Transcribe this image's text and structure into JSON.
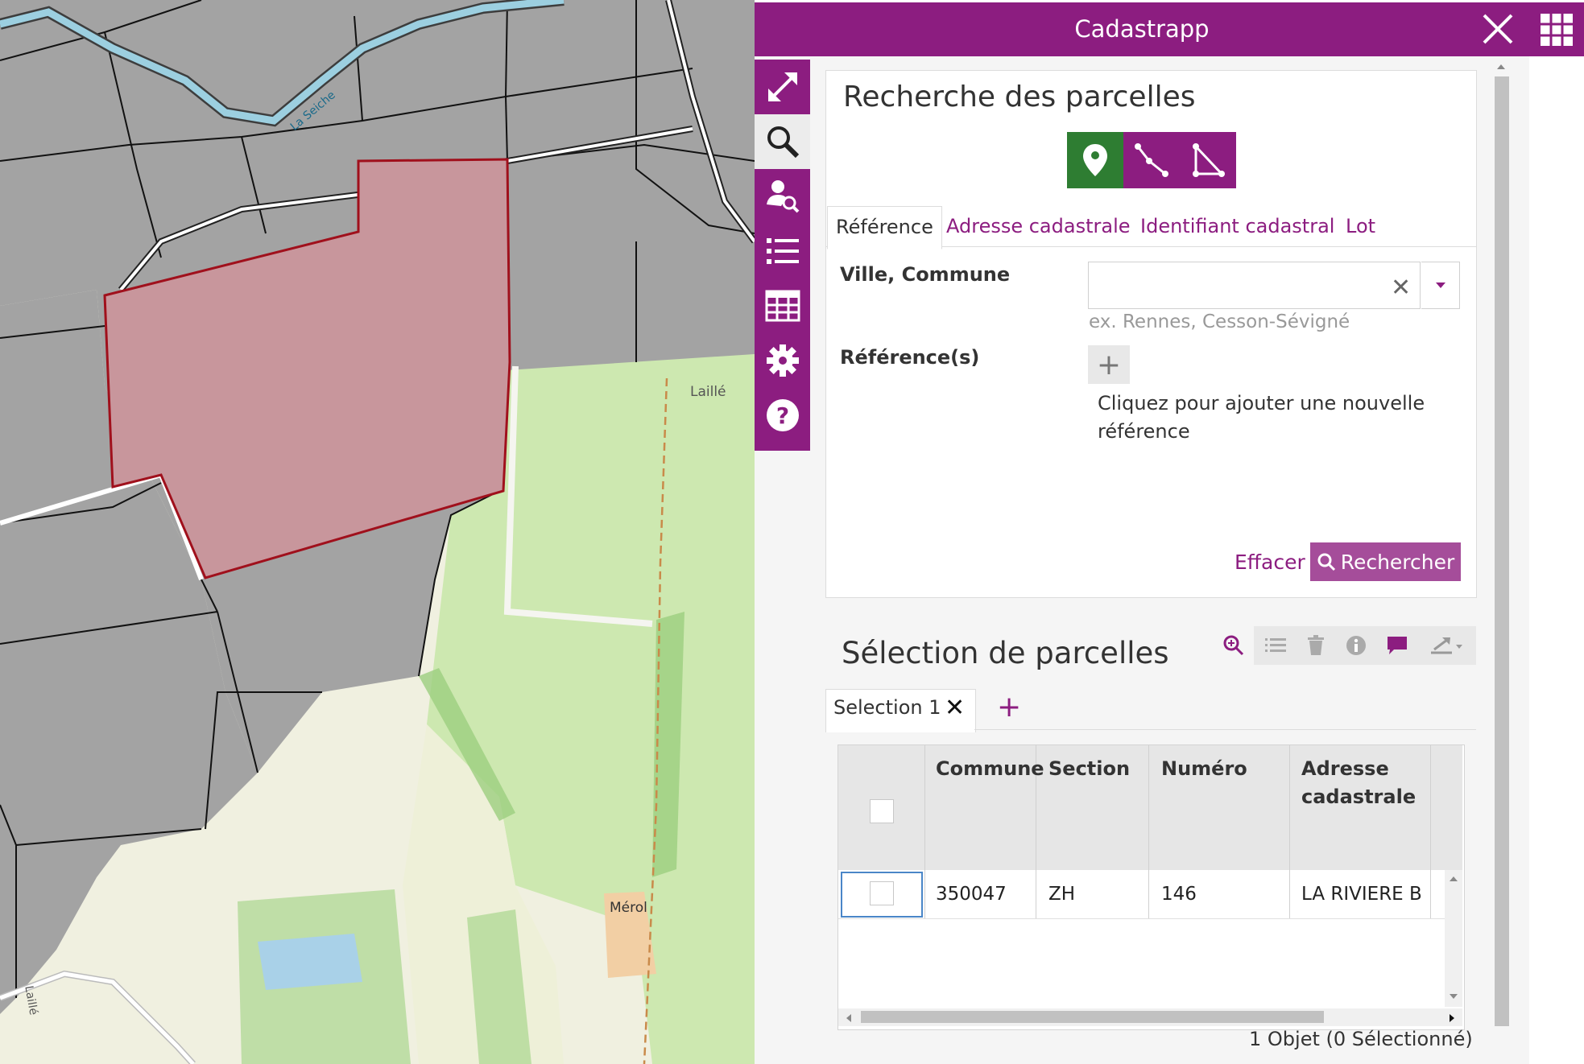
{
  "app": {
    "title": "Cadastrapp"
  },
  "map": {
    "labels": {
      "river": "La Seiche",
      "town_north": "Laillé",
      "hamlet": "Mérol",
      "town_south": "Laillé"
    }
  },
  "toolbar": {
    "items": [
      {
        "icon": "expand-icon"
      },
      {
        "icon": "search-icon"
      },
      {
        "icon": "owner-search-icon"
      },
      {
        "icon": "list-icon"
      },
      {
        "icon": "table-icon"
      },
      {
        "icon": "gear-icon"
      },
      {
        "icon": "help-icon"
      }
    ]
  },
  "search": {
    "title": "Recherche des parcelles",
    "tabs": [
      "Référence",
      "Adresse cadastrale",
      "Identifiant cadastral",
      "Lot"
    ],
    "commune_label": "Ville, Commune",
    "commune_value": "",
    "commune_hint": "ex. Rennes, Cesson-Sévigné",
    "references_label": "Référence(s)",
    "add_reference_hint": "Cliquez pour ajouter une nouvelle référence",
    "clear_label": "Effacer",
    "search_label": "Rechercher"
  },
  "selection": {
    "title": "Sélection de parcelles",
    "tab_label": "Selection 1",
    "columns": [
      "Commune",
      "Section",
      "Numéro",
      "Adresse cadastrale"
    ],
    "rows": [
      {
        "commune": "350047",
        "section": "ZH",
        "numero": "146",
        "adresse": "LA RIVIERE B"
      }
    ],
    "status": "1 Objet  (0 Sélectionné)"
  },
  "colors": {
    "accent": "#8c1d80",
    "map_selection": "#c8969c",
    "active_mode": "#2e7d32"
  }
}
